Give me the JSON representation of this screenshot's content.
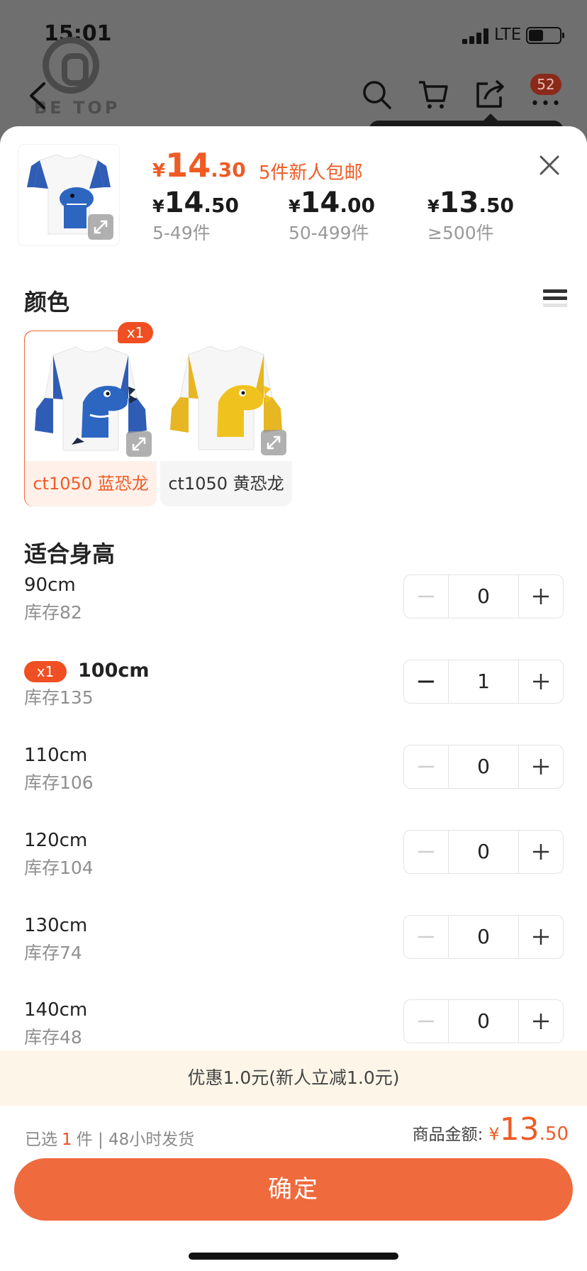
{
  "status_bar": {
    "time": "15:01",
    "network": "LTE"
  },
  "brand": {
    "logo_text": "BE  TOP"
  },
  "header": {
    "cart_badge": "52",
    "more": "•••"
  },
  "product": {
    "price": {
      "currency": "¥",
      "integer": "14",
      "decimal": ".30"
    },
    "promo": "5件新人包邮",
    "tiers": [
      {
        "currency": "¥",
        "integer": "14",
        "decimal": ".50",
        "qty": "5-49件"
      },
      {
        "currency": "¥",
        "integer": "14",
        "decimal": ".00",
        "qty": "50-499件"
      },
      {
        "currency": "¥",
        "integer": "13",
        "decimal": ".50",
        "qty": "≥500件"
      }
    ]
  },
  "color_section": {
    "title": "颜色",
    "options": [
      {
        "label": "ct1050 蓝恐龙",
        "badge": "x1",
        "selected": true,
        "sleeve_color": "#2f5db5",
        "dino_color": "#2c66c0"
      },
      {
        "label": "ct1050 黄恐龙",
        "badge": "",
        "selected": false,
        "sleeve_color": "#e6b623",
        "dino_color": "#f0c21e"
      }
    ]
  },
  "size_section": {
    "title": "适合身高",
    "sizes": [
      {
        "name": "90cm",
        "stock": "库存82",
        "qty": "0",
        "badge": ""
      },
      {
        "name": "100cm",
        "stock": "库存135",
        "qty": "1",
        "badge": "x1"
      },
      {
        "name": "110cm",
        "stock": "库存106",
        "qty": "0",
        "badge": ""
      },
      {
        "name": "120cm",
        "stock": "库存104",
        "qty": "0",
        "badge": ""
      },
      {
        "name": "130cm",
        "stock": "库存74",
        "qty": "0",
        "badge": ""
      },
      {
        "name": "140cm",
        "stock": "库存48",
        "qty": "0",
        "badge": ""
      }
    ]
  },
  "discount": "优惠1.0元(新人立减1.0元)",
  "summary": {
    "selected_prefix": "已选",
    "selected_count": "1",
    "selected_suffix": "件 | 48小时发货",
    "amount_label": "商品金额:",
    "currency": "¥",
    "integer": "13",
    "decimal": ".50"
  },
  "confirm_label": "确定",
  "colors": {
    "accent": "#ef6a3d",
    "price": "#ef5b25",
    "badge": "#ef4f22",
    "discount_bg": "#fdf6e8"
  }
}
